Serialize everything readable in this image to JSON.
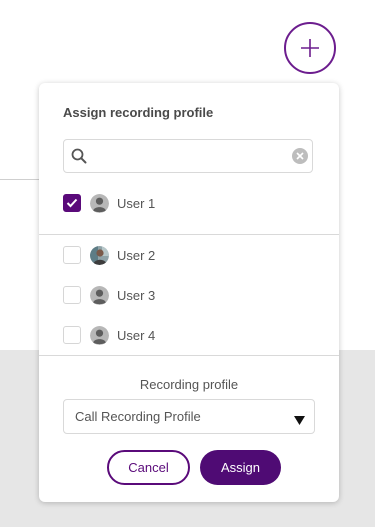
{
  "fab": {
    "icon": "plus-icon"
  },
  "panel": {
    "title": "Assign recording profile",
    "search": {
      "placeholder": "",
      "value": ""
    },
    "users": [
      {
        "name": "User 1",
        "checked": true,
        "avatar": "default-avatar"
      },
      {
        "name": "User 2",
        "checked": false,
        "avatar": "photo-avatar"
      },
      {
        "name": "User 3",
        "checked": false,
        "avatar": "default-avatar"
      },
      {
        "name": "User 4",
        "checked": false,
        "avatar": "default-avatar"
      }
    ],
    "recording_profile_label": "Recording profile",
    "recording_profile_selected": "Call Recording Profile",
    "cancel_label": "Cancel",
    "assign_label": "Assign"
  },
  "colors": {
    "accent": "#5a0a7a",
    "accent_fill": "#4f0b74",
    "background_band": "#e6e6e6"
  }
}
